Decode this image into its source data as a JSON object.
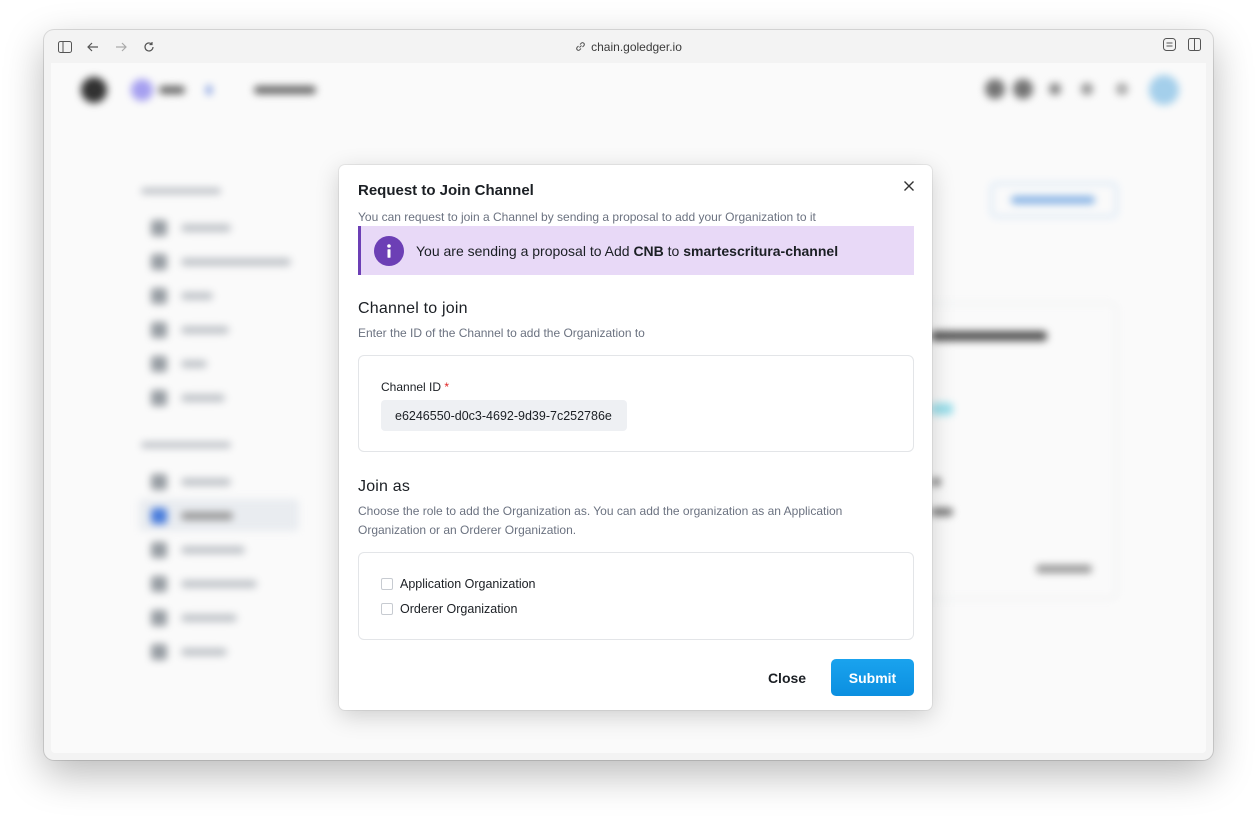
{
  "browser": {
    "url": "chain.goledger.io"
  },
  "modal": {
    "title": "Request to Join Channel",
    "subtitle": "You can request to join a Channel by sending a proposal to add your Organization to it",
    "alert": {
      "prefix": "You are sending a proposal to Add ",
      "org": "CNB",
      "middle": " to ",
      "channel": "smartescritura-channel"
    },
    "channel_section": {
      "title": "Channel to join",
      "description": "Enter the ID of the Channel to add the Organization to",
      "field_label": "Channel ID",
      "required_mark": "*",
      "field_value": "e6246550-d0c3-4692-9d39-7c252786e"
    },
    "join_section": {
      "title": "Join as",
      "description": "Choose the role to add the Organization as. You can add the organization as an Application Organization or an Orderer Organization.",
      "options": [
        {
          "label": "Application Organization",
          "checked": false
        },
        {
          "label": "Orderer Organization",
          "checked": false
        }
      ]
    },
    "buttons": {
      "close": "Close",
      "submit": "Submit"
    }
  },
  "colors": {
    "accent": "#0b8fe0",
    "alert_bg": "#e8d9f7",
    "alert_border": "#6c3fb5"
  }
}
